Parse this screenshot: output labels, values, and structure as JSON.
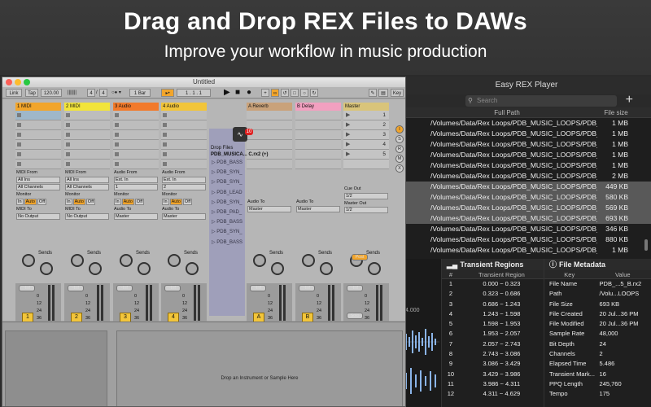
{
  "hero": {
    "title": "Drag and Drop REX Files to DAWs",
    "subtitle": "Improve your workflow in music production"
  },
  "rex_player": {
    "title": "Easy REX Player",
    "search_placeholder": "Search",
    "columns": [
      "Full Path",
      "File size"
    ],
    "rows": [
      {
        "path": "/Volumes/Data/Rex Loops/PDB_MUSIC_LOOPS/PDB_M...",
        "size": "1 MB",
        "selected": false
      },
      {
        "path": "/Volumes/Data/Rex Loops/PDB_MUSIC_LOOPS/PDB_S...",
        "size": "1 MB",
        "selected": false
      },
      {
        "path": "/Volumes/Data/Rex Loops/PDB_MUSIC_LOOPS/PDB_S...",
        "size": "1 MB",
        "selected": false
      },
      {
        "path": "/Volumes/Data/Rex Loops/PDB_MUSIC_LOOPS/PDB_S...",
        "size": "1 MB",
        "selected": false
      },
      {
        "path": "/Volumes/Data/Rex Loops/PDB_MUSIC_LOOPS/PDB_L...",
        "size": "1 MB",
        "selected": false
      },
      {
        "path": "/Volumes/Data/Rex Loops/PDB_MUSIC_LOOPS/PDB_B...",
        "size": "2 MB",
        "selected": false
      },
      {
        "path": "/Volumes/Data/Rex Loops/PDB_MUSIC_LOOPS/PDB_B...",
        "size": "449 KB",
        "selected": true
      },
      {
        "path": "/Volumes/Data/Rex Loops/PDB_MUSIC_LOOPS/PDB_B...",
        "size": "580 KB",
        "selected": true
      },
      {
        "path": "/Volumes/Data/Rex Loops/PDB_MUSIC_LOOPS/PDB_S...",
        "size": "569 KB",
        "selected": true
      },
      {
        "path": "/Volumes/Data/Rex Loops/PDB_MUSIC_LOOPS/PDB_B...",
        "size": "693 KB",
        "selected": true
      },
      {
        "path": "/Volumes/Data/Rex Loops/PDB_MUSIC_LOOPS/PDB_B...",
        "size": "346 KB",
        "selected": false
      },
      {
        "path": "/Volumes/Data/Rex Loops/PDB_MUSIC_LOOPS/PDB_P...",
        "size": "880 KB",
        "selected": false
      },
      {
        "path": "/Volumes/Data/Rex Loops/PDB_MUSIC_LOOPS/PDB_L...",
        "size": "1 MB",
        "selected": false
      }
    ],
    "waveform_tick": "4.000",
    "transients": {
      "title": "Transient Regions",
      "columns": [
        "#",
        "Transient Region"
      ],
      "rows": [
        [
          "1",
          "0.000 ~ 0.323"
        ],
        [
          "2",
          "0.323 ~ 0.686"
        ],
        [
          "3",
          "0.686 ~ 1.243"
        ],
        [
          "4",
          "1.243 ~ 1.598"
        ],
        [
          "5",
          "1.598 ~ 1.953"
        ],
        [
          "6",
          "1.953 ~ 2.057"
        ],
        [
          "7",
          "2.057 ~ 2.743"
        ],
        [
          "8",
          "2.743 ~ 3.086"
        ],
        [
          "9",
          "3.086 ~ 3.429"
        ],
        [
          "10",
          "3.429 ~ 3.986"
        ],
        [
          "11",
          "3.986 ~ 4.311"
        ],
        [
          "12",
          "4.311 ~ 4.629"
        ]
      ]
    },
    "metadata": {
      "title": "File Metadata",
      "columns": [
        "Key",
        "Value"
      ],
      "rows": [
        [
          "File Name",
          "PDB_...5_B.rx2"
        ],
        [
          "Path",
          "/Volu...LOOPS"
        ],
        [
          "File Size",
          "693 KB"
        ],
        [
          "File Created",
          "20 Jul...36 PM"
        ],
        [
          "File Modified",
          "20 Jul...36 PM"
        ],
        [
          "Sample Rate",
          "48,000"
        ],
        [
          "Bit Depth",
          "24"
        ],
        [
          "Channels",
          "2"
        ],
        [
          "Elapsed Time",
          "5.486"
        ],
        [
          "Transient Mark...",
          "16"
        ],
        [
          "PPQ Length",
          "245,760"
        ],
        [
          "Tempo",
          "175"
        ]
      ]
    }
  },
  "ableton": {
    "window_title": "Untitled",
    "toolbar": {
      "link": "Link",
      "tap": "Tap",
      "tempo": "120.00",
      "sig_num": "4",
      "sig_den": "4",
      "quantize": "1 Bar",
      "position": "1 .   1 .   1",
      "key": "Key"
    },
    "tracks": [
      {
        "name": "1 MIDI",
        "color": "#f2a52b",
        "in_label": "MIDI From",
        "in_src": "All Ins",
        "in_ch": "All Channels",
        "out_label": "MIDI To",
        "out_dst": "No Output",
        "num": "1"
      },
      {
        "name": "2 MIDI",
        "color": "#f2e43a",
        "in_label": "MIDI From",
        "in_src": "All Ins",
        "in_ch": "All Channels",
        "out_label": "MIDI To",
        "out_dst": "No Output",
        "num": "2"
      },
      {
        "name": "3 Audio",
        "color": "#f27a2b",
        "in_label": "Audio From",
        "in_src": "Ext. In",
        "in_ch": "1",
        "out_label": "Audio To",
        "out_dst": "Master",
        "num": "3"
      },
      {
        "name": "4 Audio",
        "color": "#f2c53a",
        "in_label": "Audio From",
        "in_src": "Ext. In",
        "in_ch": "2",
        "out_label": "Audio To",
        "out_dst": "Master",
        "num": "4"
      }
    ],
    "monitor": {
      "label": "Monitor",
      "in": "In",
      "auto": "Auto",
      "off": "Off"
    },
    "sends_label": "Sends",
    "inf": "-Inf",
    "scale": [
      "0",
      "12",
      "24",
      "36",
      "48",
      "60"
    ],
    "returns": [
      {
        "name": "A Reverb",
        "color": "#c9a27a",
        "out_label": "Audio To",
        "out_dst": "Master",
        "btn": "A"
      },
      {
        "name": "B Delay",
        "color": "#f2a0c0",
        "out_label": "Audio To",
        "out_dst": "Master",
        "btn": "B"
      },
      {
        "name": "Master",
        "color": "#d9c47a",
        "cue_label": "Cue Out",
        "cue": "1/2",
        "out_label": "Master Out",
        "out_dst": "1/2",
        "post": "Post",
        "solo": "Solo"
      }
    ],
    "master_scenes": [
      "1",
      "2",
      "3",
      "4",
      "5"
    ],
    "drop": {
      "label": "Drop Files",
      "header": "PDB_MUSICA... C.rx2 (+)",
      "items": [
        "PDB_BASS",
        "PDB_SYN_",
        "PDB_SYN_",
        "PDB_LEAD",
        "PDB_SYN_",
        "PDB_PAD_",
        "PDB_BASS",
        "PDB_SYN_",
        "PDB_BASS"
      ],
      "count_badge": "10"
    },
    "instrument_drop": "Drop an Instrument or Sample Here"
  }
}
